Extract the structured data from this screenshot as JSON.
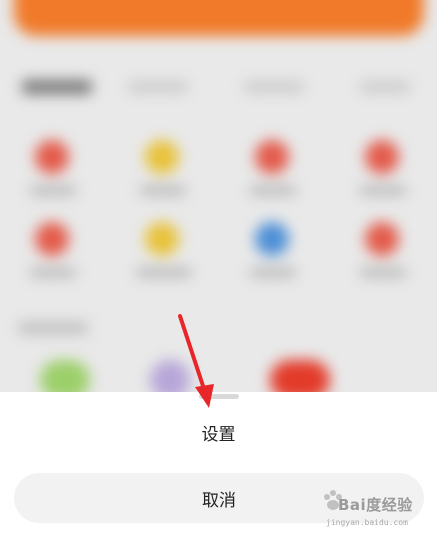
{
  "sheet": {
    "settings_label": "设置",
    "cancel_label": "取消"
  },
  "watermark": {
    "brand": "Bai度经验",
    "url": "jingyan.baidu.com"
  },
  "colors": {
    "accent_orange": "#f07a2a",
    "annotation_red": "#e8262a",
    "sheet_background": "#ffffff",
    "cancel_button_bg": "#f2f2f2"
  },
  "icons": [
    "annotation-arrow-icon",
    "baidu-paw-icon"
  ]
}
